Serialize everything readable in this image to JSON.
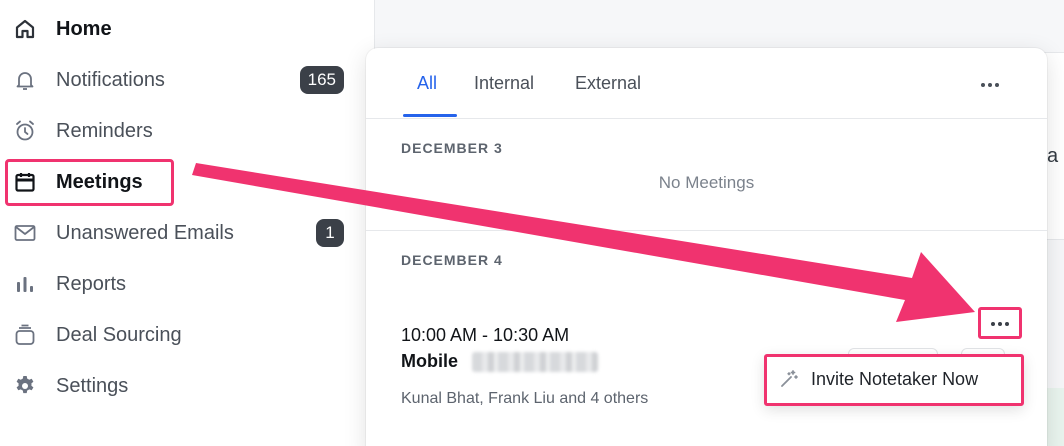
{
  "sidebar": {
    "items": [
      {
        "label": "Home",
        "icon": "home-icon",
        "active": false,
        "badge": null
      },
      {
        "label": "Notifications",
        "icon": "bell-icon",
        "active": false,
        "badge": "165"
      },
      {
        "label": "Reminders",
        "icon": "alarm-clock-icon",
        "active": false,
        "badge": null
      },
      {
        "label": "Meetings",
        "icon": "calendar-icon",
        "active": true,
        "badge": null
      },
      {
        "label": "Unanswered Emails",
        "icon": "mail-icon",
        "active": false,
        "badge": "1"
      },
      {
        "label": "Reports",
        "icon": "bar-chart-icon",
        "active": false,
        "badge": null
      },
      {
        "label": "Deal Sourcing",
        "icon": "stack-icon",
        "active": false,
        "badge": null
      },
      {
        "label": "Settings",
        "icon": "gear-icon",
        "active": false,
        "badge": null
      }
    ]
  },
  "background": {
    "partial_text": "a"
  },
  "meetings_panel": {
    "tabs": [
      {
        "label": "All",
        "active": true
      },
      {
        "label": "Internal",
        "active": false
      },
      {
        "label": "External",
        "active": false
      }
    ],
    "days": [
      {
        "date_label": "DECEMBER 3",
        "empty_text": "No Meetings"
      },
      {
        "date_label": "DECEMBER 4"
      }
    ],
    "meeting": {
      "time": "10:00 AM - 10:30 AM",
      "title": "Mobile",
      "attendees": "Kunal Bhat, Frank Liu and 4 others"
    },
    "menu": {
      "invite_label": "Invite Notetaker Now",
      "invite_icon": "magic-wand-icon"
    }
  },
  "colors": {
    "accent": "#2563eb",
    "highlight": "#f0336f",
    "badge_bg": "#3b4048"
  }
}
